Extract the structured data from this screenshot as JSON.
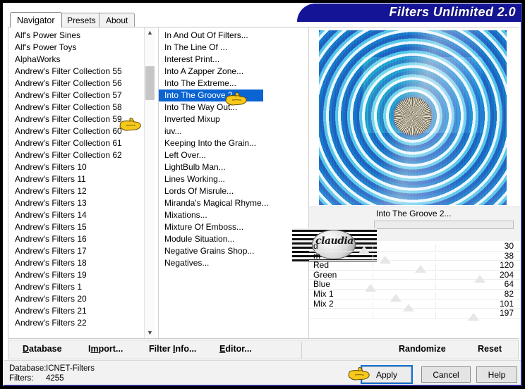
{
  "window": {
    "title": "Filters Unlimited 2.0"
  },
  "tabs": [
    {
      "label": "Navigator",
      "active": true
    },
    {
      "label": "Presets",
      "active": false
    },
    {
      "label": "About",
      "active": false
    }
  ],
  "left_list": {
    "items": [
      "Alf's Power Sines",
      "Alf's Power Toys",
      "AlphaWorks",
      "Andrew's Filter Collection 55",
      "Andrew's Filter Collection 56",
      "Andrew's Filter Collection 57",
      "Andrew's Filter Collection 58",
      "Andrew's Filter Collection 59",
      "Andrew's Filter Collection 60",
      "Andrew's Filter Collection 61",
      "Andrew's Filter Collection 62",
      "Andrew's Filters 10",
      "Andrew's Filters 11",
      "Andrew's Filters 12",
      "Andrew's Filters 13",
      "Andrew's Filters 14",
      "Andrew's Filters 15",
      "Andrew's Filters 16",
      "Andrew's Filters 17",
      "Andrew's Filters 18",
      "Andrew's Filters 19",
      "Andrew's Filters 1",
      "Andrew's Filters 20",
      "Andrew's Filters 21",
      "Andrew's Filters 22"
    ],
    "hovered_index": 7
  },
  "mid_list": {
    "items": [
      "In And Out Of Filters...",
      "In The Line Of ...",
      "Interest Print...",
      "Into A Zapper Zone...",
      "Into The Extreme...",
      "Into The Groove 2...",
      "Into The Way Out...",
      "Inverted Mixup",
      "iuv...",
      "Keeping Into the Grain...",
      "Left Over...",
      "LightBulb Man...",
      "Lines Working...",
      "Lords Of Misrule...",
      "Miranda's Magical Rhyme...",
      "Mixations...",
      "Mixture Of Emboss...",
      "Module Situation...",
      "Negative Grains Shop...",
      "Negatives..."
    ],
    "selected_index": 5,
    "selected_label": "Into The Groove 2..."
  },
  "preview": {
    "filter_name": "Into The Groove 2...",
    "watermark_text": "claudia"
  },
  "sliders": [
    {
      "label": "d",
      "value": "30",
      "pos_pct": 26
    },
    {
      "label": "m",
      "value": "38",
      "pos_pct": 36
    },
    {
      "label": "Red",
      "value": "120",
      "pos_pct": 53
    },
    {
      "label": "Green",
      "value": "204",
      "pos_pct": 81
    },
    {
      "label": "Blue",
      "value": "64",
      "pos_pct": 29
    },
    {
      "label": "Mix 1",
      "value": "82",
      "pos_pct": 41
    },
    {
      "label": "Mix 2",
      "value": "101",
      "pos_pct": 47
    },
    {
      "label": "",
      "value": "197",
      "pos_pct": 78
    }
  ],
  "toolbar": {
    "database": "Database",
    "database_accel": "D",
    "import": "Import...",
    "import_accel": "m",
    "filter_info": "Filter Info...",
    "filter_info_accel": "I",
    "editor": "Editor...",
    "editor_accel": "E",
    "randomize": "Randomize",
    "reset": "Reset"
  },
  "status": {
    "database_label": "Database:",
    "database_value": "ICNET-Filters",
    "filters_label": "Filters:",
    "filters_value": "4255"
  },
  "buttons": {
    "apply": "Apply",
    "cancel": "Cancel",
    "help": "Help"
  },
  "colors": {
    "title_banner": "#141496",
    "selection": "#0a64d2",
    "focus_outline": "#1473d6",
    "hand_cursor": "#f5c518"
  },
  "icons": {
    "scroll_up": "▲",
    "scroll_down": "▼"
  }
}
